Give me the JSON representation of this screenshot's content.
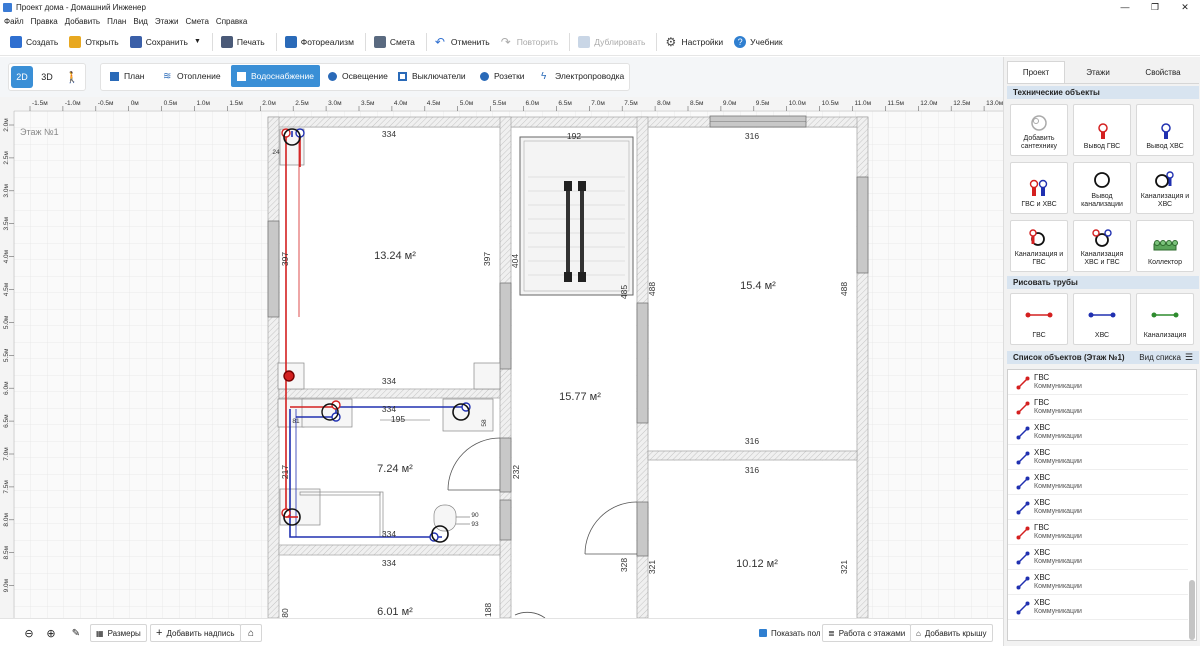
{
  "window": {
    "title": "Проект дома - Домашний Инженер"
  },
  "menu": [
    "Файл",
    "Правка",
    "Добавить",
    "План",
    "Вид",
    "Этажи",
    "Смета",
    "Справка"
  ],
  "toolbar": {
    "create": "Создать",
    "open": "Открыть",
    "save": "Сохранить",
    "print": "Печать",
    "photoreal": "Фотореализм",
    "estimate": "Смета",
    "undo": "Отменить",
    "redo": "Повторить",
    "duplicate": "Дублировать",
    "settings": "Настройки",
    "tutorial": "Учебник"
  },
  "modes": {
    "d2": "2D",
    "d3": "3D"
  },
  "nav": [
    "План",
    "Отопление",
    "Водоснабжение",
    "Освещение",
    "Выключатели",
    "Розетки",
    "Электропроводка"
  ],
  "nav_active": "Водоснабжение",
  "ruler_x": [
    "-1.5м",
    "-1.0м",
    "-0.5м",
    "0м",
    "0.5м",
    "1.0м",
    "1.5м",
    "2.0м",
    "2.5м",
    "3.0м",
    "3.5м",
    "4.0м",
    "4.5м",
    "5.0м",
    "5.5м",
    "6.0м",
    "6.5м",
    "7.0м",
    "7.5м",
    "8.0м",
    "8.5м",
    "9.0м",
    "9.5м",
    "10.0м",
    "10.5м",
    "11.0м",
    "11.5м",
    "12.0м",
    "12.5м",
    "13.0м"
  ],
  "ruler_y": [
    "2.0м",
    "2.5м",
    "3.0м",
    "3.5м",
    "4.0м",
    "4.5м",
    "5.0м",
    "5.5м",
    "6.0м",
    "6.5м",
    "7.0м",
    "7.5м",
    "8.0м",
    "8.5м",
    "9.0м"
  ],
  "floor_label": "Этаж №1",
  "plan": {
    "rooms": [
      {
        "area": "13.24 м²"
      },
      {
        "area": "15.4 м²"
      },
      {
        "area": "15.77 м²"
      },
      {
        "area": "7.24 м²"
      },
      {
        "area": "10.12 м²"
      },
      {
        "area": "6.01 м²"
      }
    ],
    "dims": [
      "334",
      "192",
      "316",
      "397",
      "397",
      "404",
      "488",
      "488",
      "334",
      "334",
      "195",
      "316",
      "316",
      "217",
      "232",
      "334",
      "334",
      "328",
      "321",
      "321",
      "80",
      "188",
      "485",
      "24",
      "90",
      "93",
      "58",
      "81"
    ]
  },
  "status": {
    "measure": "Размеры",
    "add_label": "Добавить надпись",
    "show_floor": "Показать пол",
    "floors_work": "Работа с этажами",
    "add_roof": "Добавить крышу"
  },
  "panel": {
    "tabs": [
      "Проект",
      "Этажи",
      "Свойства"
    ],
    "tech_title": "Технические объекты",
    "tiles": [
      "Добавить сантехнику",
      "Вывод ГВС",
      "Вывод ХВС",
      "ГВС и ХВС",
      "Вывод канализации",
      "Канализация и ХВС",
      "Канализация и ГВС",
      "Канализация ХВС и ГВС",
      "Коллектор"
    ],
    "pipes_title": "Рисовать трубы",
    "pipes": [
      "ГВС",
      "ХВС",
      "Канализация"
    ],
    "list_title": "Список объектов (Этаж №1)",
    "list_view": "Вид списка",
    "objects": [
      {
        "name": "ГВС",
        "sub": "Коммуникации",
        "color": "#d42020"
      },
      {
        "name": "ГВС",
        "sub": "Коммуникации",
        "color": "#d42020"
      },
      {
        "name": "ХВС",
        "sub": "Коммуникации",
        "color": "#2030b0"
      },
      {
        "name": "ХВС",
        "sub": "Коммуникации",
        "color": "#2030b0"
      },
      {
        "name": "ХВС",
        "sub": "Коммуникации",
        "color": "#2030b0"
      },
      {
        "name": "ХВС",
        "sub": "Коммуникации",
        "color": "#2030b0"
      },
      {
        "name": "ГВС",
        "sub": "Коммуникации",
        "color": "#d42020"
      },
      {
        "name": "ХВС",
        "sub": "Коммуникации",
        "color": "#2030b0"
      },
      {
        "name": "ХВС",
        "sub": "Коммуникации",
        "color": "#2030b0"
      },
      {
        "name": "ХВС",
        "sub": "Коммуникации",
        "color": "#2030b0"
      }
    ]
  },
  "colors": {
    "accent": "#3a8fd6",
    "hot": "#d42020",
    "cold": "#2030b0",
    "sewer": "#2e8b2e"
  }
}
